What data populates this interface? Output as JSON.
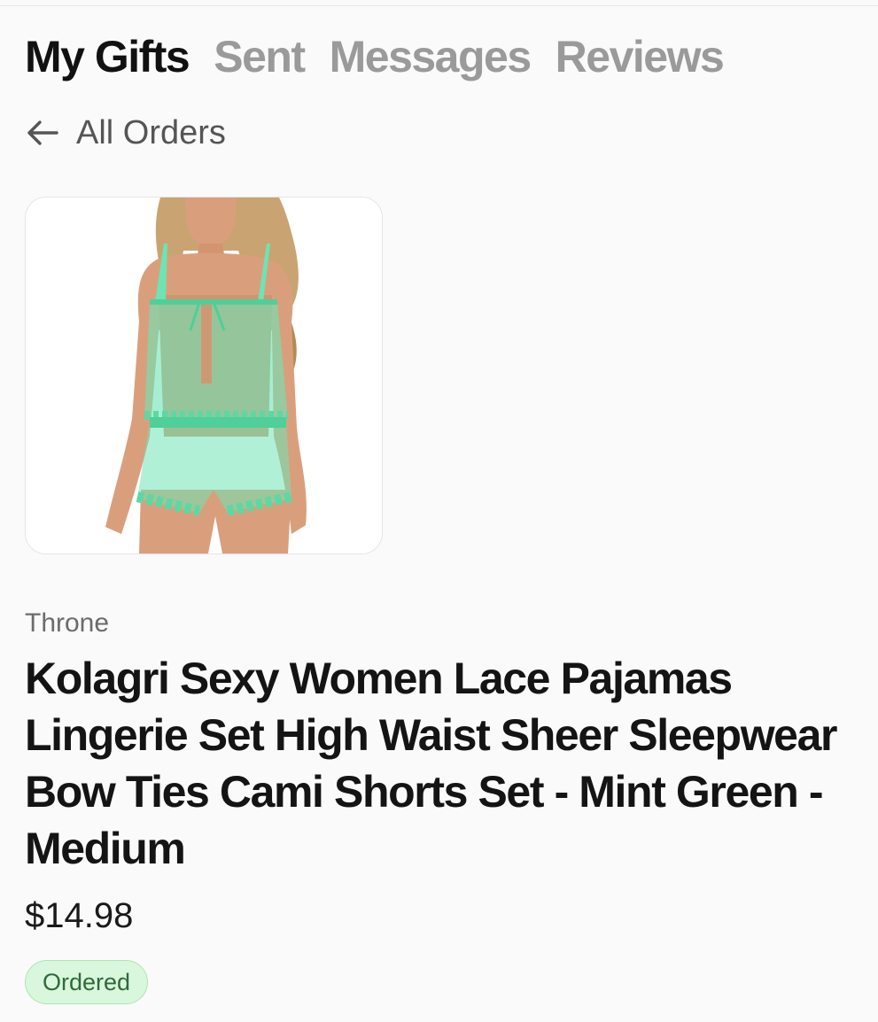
{
  "tabs": [
    {
      "label": "My Gifts",
      "active": true
    },
    {
      "label": "Sent",
      "active": false
    },
    {
      "label": "Messages",
      "active": false
    },
    {
      "label": "Reviews",
      "active": false
    }
  ],
  "back": {
    "icon": "arrow-left-icon",
    "label": "All Orders"
  },
  "product": {
    "image": "product-photo",
    "brand": "Throne",
    "title": "Kolagri Sexy Women Lace Pajamas Lingerie Set High Waist Sheer Sleepwear Bow Ties Cami Shorts Set - Mint Green - Medium",
    "price": "$14.98",
    "status": "Ordered"
  },
  "colors": {
    "active_tab": "#111111",
    "inactive_tab": "#9a9a9a",
    "status_bg": "#d9f7dd",
    "status_text": "#2f6a3a",
    "garment": "#6fe3b4"
  }
}
